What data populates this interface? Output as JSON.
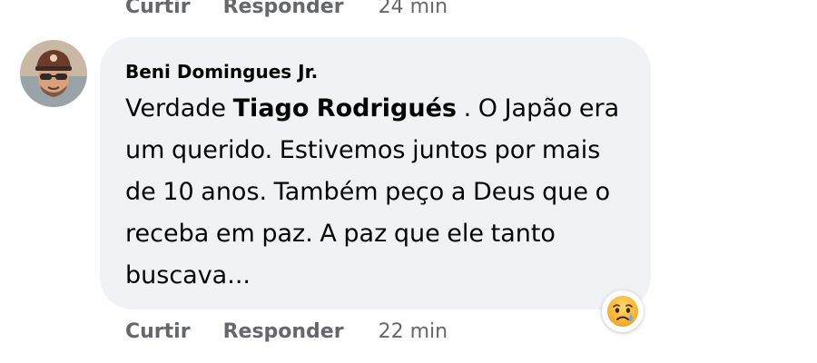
{
  "previous_comment": {
    "like_label": "Curtir",
    "reply_label": "Responder",
    "time": "24 min"
  },
  "comment": {
    "author": "Beni Domingues Jr.",
    "text_before_mention": "Verdade ",
    "mention": "Tiago Rodrigués",
    "text_after_mention": " . O Japão era um querido. Estivemos juntos por mais de 10 anos. Também peço a Deus que o receba em paz. A paz que ele tanto buscava...",
    "reaction_icon": "sad-emoji-icon",
    "like_label": "Curtir",
    "reply_label": "Responder",
    "time": "22 min"
  },
  "colors": {
    "bubble_bg": "#f0f2f5",
    "text": "#050505",
    "secondary_text": "#65676b",
    "reaction_face": "#f7b125"
  }
}
